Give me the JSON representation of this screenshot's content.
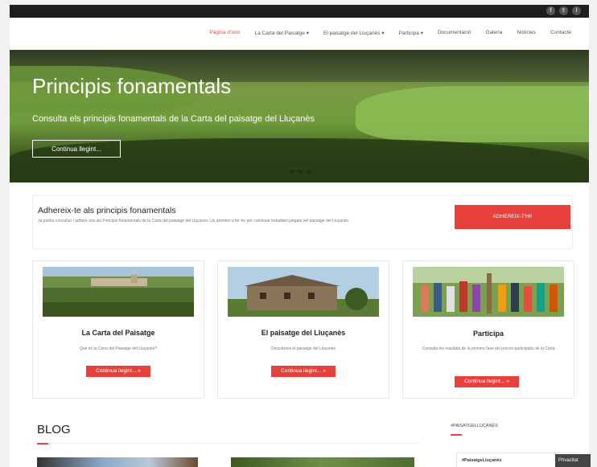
{
  "header": {
    "social": [
      {
        "icon": "facebook-icon",
        "glyph": "f"
      },
      {
        "icon": "twitter-icon",
        "glyph": "t"
      },
      {
        "icon": "instagram-icon",
        "glyph": "i"
      }
    ],
    "nav": [
      {
        "label": "Pàgina d'inici",
        "active": true
      },
      {
        "label": "La Carta del Paisatge ▾",
        "active": false
      },
      {
        "label": "El paisatge del Lluçanès ▾",
        "active": false
      },
      {
        "label": "Participa ▾",
        "active": false
      },
      {
        "label": "Documentació",
        "active": false
      },
      {
        "label": "Galeria",
        "active": false
      },
      {
        "label": "Notícies",
        "active": false
      },
      {
        "label": "Contacte",
        "active": false
      }
    ]
  },
  "hero": {
    "title": "Principis fonamentals",
    "subtitle": "Consulta els principis fonamentals de la Carta del paisatge del Lluçanès",
    "button": "Continua llegint..."
  },
  "cta": {
    "title": "Adhereix-te als principis fonamentals",
    "text": "Ja podeu consultar i adherir-vos als Principis fonamentals de la Carta del paisatge del Lluçanès. Us animem a fer-ho per continuar treballant plegats pel paisatge del Lluçanès",
    "button": "ADHEREIX-T'HI!"
  },
  "cards": [
    {
      "title": "La Carta del Paisatge",
      "text": "Què és la Carta del Paisatge del Lluçanès?",
      "button": "Continua llegint... »"
    },
    {
      "title": "El paisatge del Lluçanès",
      "text": "Descobreix el paisatge del Lluçanès",
      "button": "Continua llegint... »"
    },
    {
      "title": "Participa",
      "text": "Consulta els resultats de la primera fase del procés participatiu de la Carta",
      "button": "Continua llegint... »"
    }
  ],
  "blog": {
    "title": "BLOG"
  },
  "sidebar": {
    "title": "#PAISATGELLUÇANÈS",
    "twitter_label": "#PaisatgeLluçanès",
    "privacy": "Privacitat"
  },
  "colors": {
    "accent": "#e8403c",
    "topbar": "#1e1e1e"
  }
}
